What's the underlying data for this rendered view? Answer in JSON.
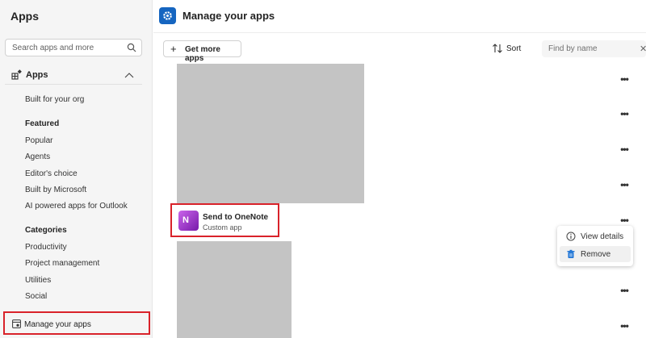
{
  "sidebar": {
    "title": "Apps",
    "search_placeholder": "Search apps and more",
    "apps_label": "Apps",
    "items": {
      "built_for_org": "Built for your org",
      "featured": "Featured",
      "popular": "Popular",
      "agents": "Agents",
      "editors_choice": "Editor's choice",
      "built_by_microsoft": "Built by Microsoft",
      "ai_powered": "AI powered apps for Outlook",
      "categories": "Categories",
      "productivity": "Productivity",
      "project_management": "Project management",
      "utilities": "Utilities",
      "social": "Social"
    },
    "manage_label": "Manage your apps"
  },
  "header": {
    "title": "Manage your apps"
  },
  "toolbar": {
    "get_more_label": "Get more apps",
    "sort_label": "Sort",
    "filter_placeholder": "Find by name"
  },
  "app": {
    "name": "Send to OneNote",
    "type": "Custom app",
    "icon_letter": "N"
  },
  "context_menu": {
    "view_details": "View details",
    "remove": "Remove"
  },
  "colors": {
    "accent": "#1565c0",
    "highlight": "#d9222a",
    "remove_icon": "#1e74d6"
  }
}
